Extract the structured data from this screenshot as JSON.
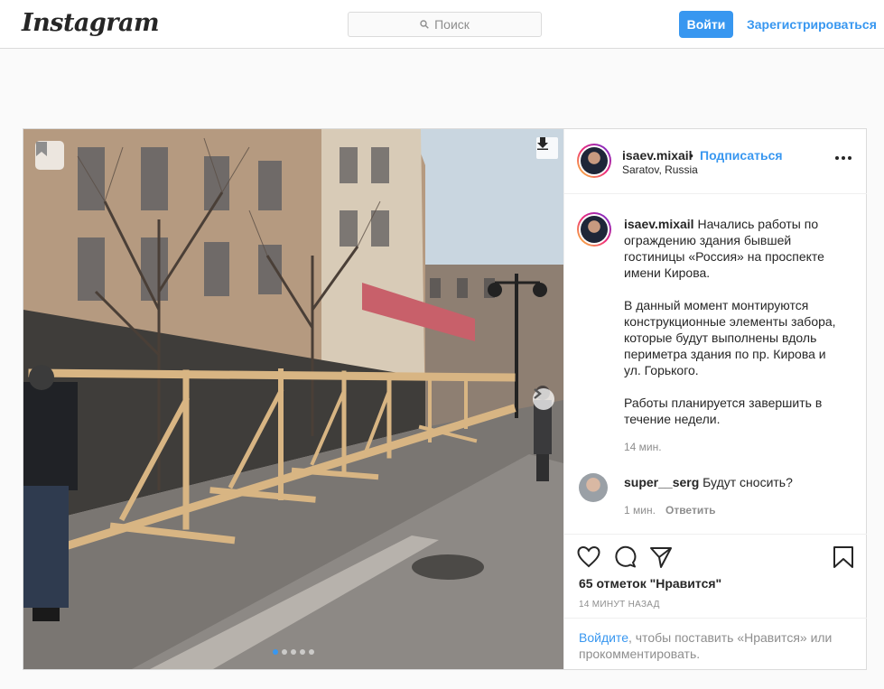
{
  "nav": {
    "logo": "Instagram",
    "search_placeholder": "Поиск",
    "login_label": "Войти",
    "register_label": "Зарегистрироваться"
  },
  "post": {
    "author": "isaev.mixail",
    "separator": "•",
    "follow_label": "Подписаться",
    "location": "Saratov, Russia",
    "caption_paragraphs": [
      "Начались работы по ограждению здания бывшей гостиницы «Россия» на проспекте имени Кирова.",
      "В данный момент монтируются конструкционные элементы забора, которые будут выполнены вдоль периметра здания по пр. Кирова и ул. Горького.",
      "Работы планируется завершить в течение недели."
    ],
    "caption_time": "14 мин.",
    "comments": [
      {
        "user": "super__serg",
        "text": "Будут сносить?",
        "time": "1 мин.",
        "reply_label": "Ответить"
      }
    ],
    "likes": "65 отметок \"Нравится\"",
    "posted_ago": "14 МИНУТ НАЗАД",
    "login_prompt": {
      "link": "Войдите",
      "rest": ", чтобы поставить «Нравится» или прокомментировать."
    },
    "carousel": {
      "total": 5,
      "active": 1
    }
  },
  "colors": {
    "accent": "#3897f0",
    "text": "#262626",
    "muted": "#8e8e8e",
    "border": "#dbdbdb"
  }
}
